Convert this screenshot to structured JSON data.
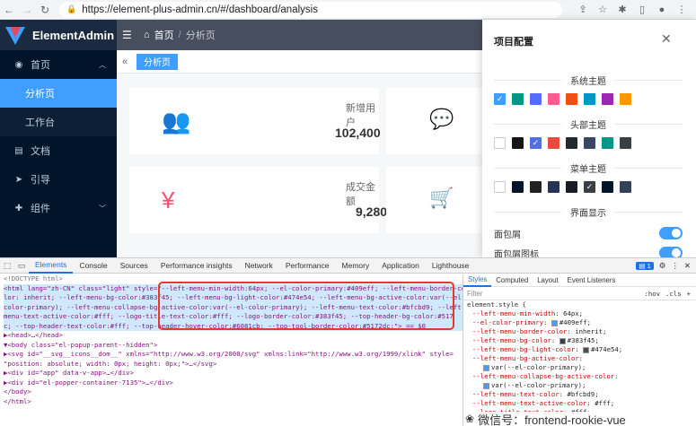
{
  "browser": {
    "url": "https://element-plus-admin.cn/#/dashboard/analysis"
  },
  "sidebar": {
    "logo_text": "ElementAdmin",
    "menu": [
      {
        "label": "首页",
        "icon": "home-icon"
      },
      {
        "label": "分析页",
        "active": true
      },
      {
        "label": "工作台"
      },
      {
        "label": "文档",
        "icon": "doc-icon"
      },
      {
        "label": "引导",
        "icon": "guide-icon"
      },
      {
        "label": "组件",
        "icon": "component-icon"
      }
    ]
  },
  "header": {
    "breadcrumb_home": "首页",
    "breadcrumb_sep": "/",
    "breadcrumb_current": "分析页"
  },
  "tags": {
    "active_tag": "分析页"
  },
  "cards": [
    {
      "label": "新增用户",
      "value": "102,400",
      "icon": "users-icon",
      "color": "#40c9c6"
    },
    {
      "label": "成交金额",
      "value": "9,280",
      "icon": "yen-icon",
      "color": "#f4516c"
    }
  ],
  "drawer": {
    "title": "项目配置",
    "system_theme": "系统主题",
    "header_theme": "头部主题",
    "menu_theme": "菜单主题",
    "display": "界面显示",
    "breadcrumb_label": "面包屑",
    "breadcrumb_icon_label": "面包屑图标",
    "system_colors": [
      "#409eff",
      "#009688",
      "#536dfe",
      "#ff5c93",
      "#ee4f12",
      "#0096c7",
      "#9c27b0",
      "#ff9800"
    ],
    "header_colors": [
      "#ffffff",
      "#151515",
      "#5172dc",
      "#e74c3c",
      "#24292e",
      "#394664",
      "#009688",
      "#383f45"
    ],
    "menu_colors": [
      "#ffffff",
      "#001529",
      "#212121",
      "#273352",
      "#191b24",
      "#383f45",
      "#001628",
      "#344058"
    ]
  },
  "devtools": {
    "tabs": [
      "Elements",
      "Console",
      "Sources",
      "Performance insights",
      "Network",
      "Performance",
      "Memory",
      "Application",
      "Lighthouse"
    ],
    "issues_count": "1",
    "elements_lines": [
      "<!DOCTYPE html>",
      "<html lang=\"zh-CN\" class=\"light\" style=\"--left-menu-min-width:64px; --el-color-primary:#409eff; --left-menu-border-co",
      "lor: inherit;  --left-menu-bg-color:#383f45;  --left-menu-bg-light-color:#474e54;  --left-menu-bg-active-color:var(--el-",
      "color-primary);  --left-menu-collapse-bg-active-color:var(--el-color-primary);  --left-menu-text-color:#bfcbd9;  --left-",
      "menu-text-active-color:#fff;  --logo-title-text-color:#fff;  --logo-border-color:#383f45;  --top-header-bg-color:#517",
      "c;  --top-header-text-color:#fff;  --top-header-hover-color:#6081cb;  --top-tool-border-color:#5172dc;\"> == $0",
      "  ▶<head>…</head>",
      "  ▼<body class=\"el-popup-parent--hidden\">",
      "    ▶<svg id=\"__svg__icons__dom__\" xmlns=\"http://www.w3.org/2000/svg\" xmlns:link=\"http://www.w3.org/1999/xlink\" style=",
      "      \"position: absolute; width: 0px; height: 0px;\">…</svg>",
      "    ▶<div id=\"app\" data-v-app>…</div>",
      "    ▶<div id=\"el-popper-container-7135\">…</div>",
      "   </body>",
      "</html>"
    ],
    "styles_tabs": [
      "Styles",
      "Computed",
      "Layout",
      "Event Listeners"
    ],
    "filter_placeholder": "Filter",
    "filter_hov": ":hov",
    "filter_cls": ".cls",
    "css_selector": "element.style {",
    "css_lines": [
      {
        "prop": "--left-menu-min-width",
        "val": "64px;"
      },
      {
        "prop": "--el-color-primary",
        "val": "#409eff;",
        "chip": "#409eff"
      },
      {
        "prop": "--left-menu-border-color",
        "val": "inherit;"
      },
      {
        "prop": "--left-menu-bg-color",
        "val": "#383f45;",
        "chip": "#383f45"
      },
      {
        "prop": "--left-menu-bg-light-color",
        "val": "#474e54;",
        "chip": "#474e54"
      },
      {
        "prop": "--left-menu-bg-active-color",
        "val": ""
      },
      {
        "prop": "",
        "val": "var(--el-color-primary);",
        "chip": "#409eff"
      },
      {
        "prop": "--left-menu-collapse-bg-active-color",
        "val": ""
      },
      {
        "prop": "",
        "val": "var(--el-color-primary);",
        "chip": "#409eff"
      },
      {
        "prop": "--left-menu-text-color",
        "val": "#bfcbd9;"
      },
      {
        "prop": "--left-menu-text-active-color",
        "val": "#fff;"
      },
      {
        "prop": "--logo-title-text-color",
        "val": "#fff;"
      }
    ]
  },
  "watermark": {
    "text": "微信号：frontend-rookie-vue"
  }
}
